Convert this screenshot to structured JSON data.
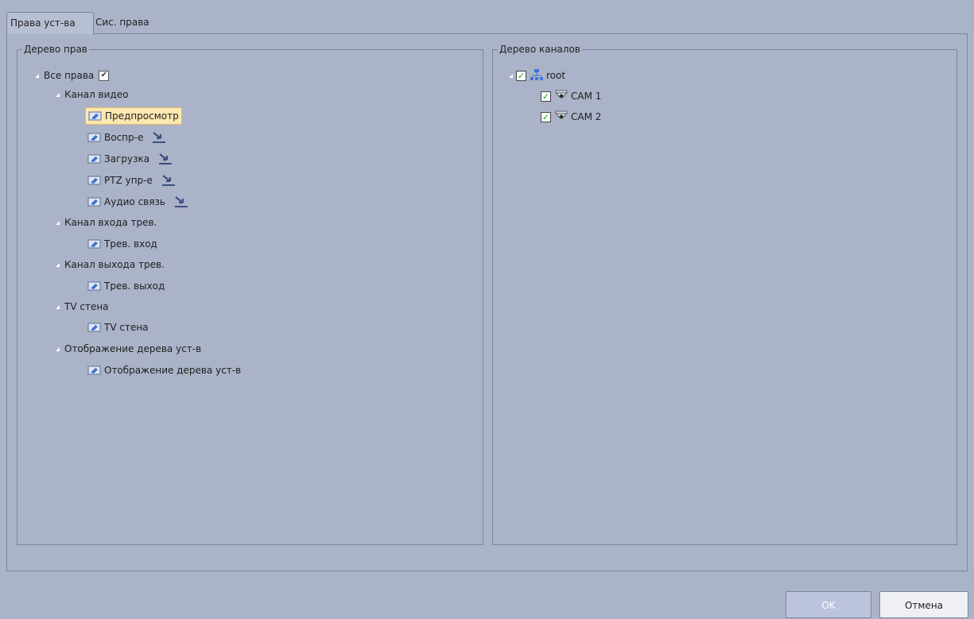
{
  "tabs": {
    "active": "Права уст-ва",
    "inactive": "Сис. права"
  },
  "rights_tree": {
    "title": "Дерево прав",
    "root": "Все права",
    "group_video": "Канал видео",
    "preview": "Предпросмотр",
    "playback": "Воспр-е",
    "download": "Загрузка",
    "ptz": "PTZ упр-е",
    "audio": "Аудио связь",
    "group_alarm_in": "Канал входа трев.",
    "alarm_in": "Трев. вход",
    "group_alarm_out": "Канал выхода трев.",
    "alarm_out": "Трев. выход",
    "group_tvwall": "TV стена",
    "tvwall": "TV стена",
    "group_devtree": "Отображение дерева уст-в",
    "devtree": "Отображение дерева уст-в"
  },
  "channel_tree": {
    "title": "Дерево каналов",
    "root": "root",
    "cam1": "CAM 1",
    "cam2": "CAM 2"
  },
  "buttons": {
    "ok": "OK",
    "cancel": "Отмена"
  },
  "colors": {
    "background": "#abb3c8",
    "check_green": "#16a016",
    "highlight": "#fde8b0"
  }
}
